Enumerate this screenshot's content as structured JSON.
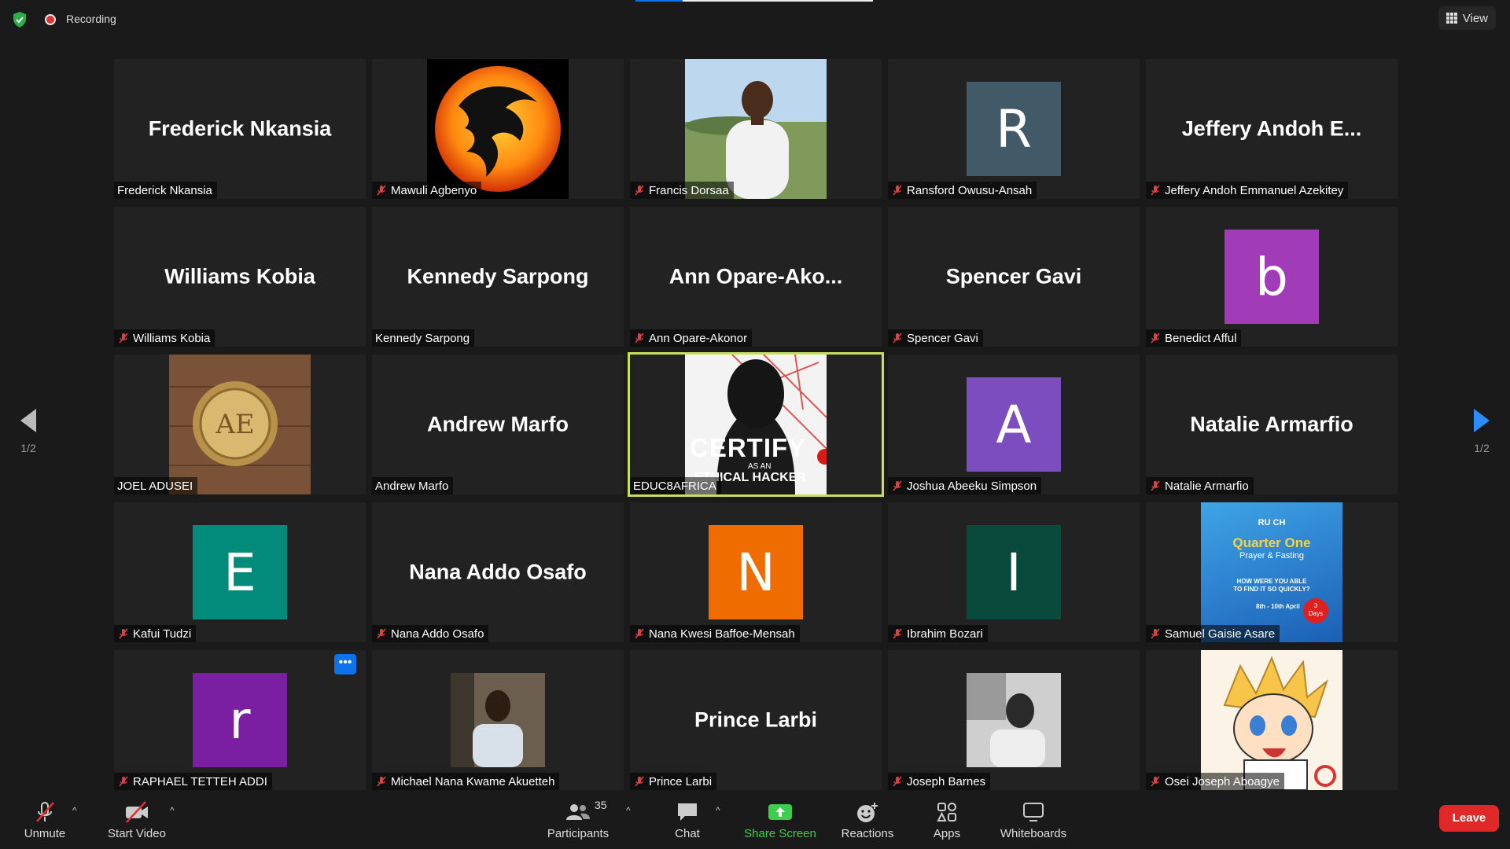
{
  "topbar": {
    "recording_label": "Recording",
    "view_label": "View"
  },
  "pager": {
    "left_label": "1/2",
    "right_label": "1/2"
  },
  "colors": {
    "active_speaker": "#c6e05a",
    "leave": "#e02828",
    "share_screen": "#3ccf4e",
    "accent": "#0e72ed"
  },
  "tiles": [
    {
      "display": "Frederick Nkansia",
      "name": "Frederick Nkansia",
      "muted": false
    },
    {
      "display": "",
      "name": "Mawuli Agbenyo",
      "muted": true,
      "image": "dragon-logo"
    },
    {
      "display": "",
      "name": "Francis Dorsaa",
      "muted": true,
      "image": "person-photo-outdoor"
    },
    {
      "display": "R",
      "name": "Ransford Owusu-Ansah",
      "muted": true,
      "avatar_color": "#425967"
    },
    {
      "display": "Jeffery  Andoh  E...",
      "name": "Jeffery Andoh Emmanuel Azekitey",
      "muted": true
    },
    {
      "display": "Williams Kobia",
      "name": "Williams Kobia",
      "muted": true
    },
    {
      "display": "Kennedy Sarpong",
      "name": "Kennedy Sarpong",
      "muted": false
    },
    {
      "display": "Ann  Opare-Ako...",
      "name": "Ann Opare-Akonor",
      "muted": true
    },
    {
      "display": "Spencer Gavi",
      "name": "Spencer Gavi",
      "muted": true
    },
    {
      "display": "b",
      "name": "Benedict Afful",
      "muted": true,
      "avatar_color": "#a23bb8"
    },
    {
      "display": "",
      "name": "JOEL ADUSEI",
      "muted": false,
      "image": "gold-emblem"
    },
    {
      "display": "Andrew Marfo",
      "name": "Andrew Marfo",
      "muted": false
    },
    {
      "display": "",
      "name": "EDUC8AFRICA",
      "muted": false,
      "active": true,
      "image": "certify-hacker",
      "poster_line1": "CERTIFY",
      "poster_line2": "AS AN",
      "poster_line3": "ETHICAL HACKER"
    },
    {
      "display": "A",
      "name": "Joshua Abeeku Simpson",
      "muted": true,
      "avatar_color": "#7c4dbf"
    },
    {
      "display": "Natalie Armarfio",
      "name": "Natalie Armarfio",
      "muted": true
    },
    {
      "display": "E",
      "name": "Kafui Tudzi",
      "muted": true,
      "avatar_color": "#028a7a"
    },
    {
      "display": "Nana Addo Osafo",
      "name": "Nana Addo Osafo",
      "muted": true
    },
    {
      "display": "N",
      "name": "Nana Kwesi Baffoe-Mensah",
      "muted": true,
      "avatar_color": "#ef6c00"
    },
    {
      "display": "I",
      "name": "Ibrahim Bozari",
      "muted": true,
      "avatar_color": "#0a4a3c"
    },
    {
      "display": "",
      "name": "Samuel Gaisie Asare",
      "muted": true,
      "image": "quarter-one-flyer",
      "flyer_brand": "RU CH",
      "flyer_title": "Quarter One",
      "flyer_sub": "Prayer & Fasting",
      "flyer_q1": "HOW WERE YOU ABLE",
      "flyer_q2": "TO FIND IT SO QUICKLY?",
      "flyer_date": "8th - 10th April",
      "flyer_days_num": "3",
      "flyer_days": "Days"
    },
    {
      "display": "r",
      "name": "RAPHAEL TETTEH ADDI",
      "muted": true,
      "avatar_color": "#7b1fa2",
      "has_more": true
    },
    {
      "display": "",
      "name": "Michael Nana Kwame Akuetteh",
      "muted": true,
      "image": "person-photo-indoor"
    },
    {
      "display": "Prince Larbi",
      "name": "Prince Larbi",
      "muted": true
    },
    {
      "display": "",
      "name": "Joseph Barnes",
      "muted": true,
      "image": "person-photo-bw"
    },
    {
      "display": "",
      "name": "Osei Joseph Aboagye",
      "muted": true,
      "image": "anime-character"
    }
  ],
  "toolbar": {
    "unmute": "Unmute",
    "start_video": "Start Video",
    "participants": "Participants",
    "participants_count": "35",
    "chat": "Chat",
    "share_screen": "Share Screen",
    "reactions": "Reactions",
    "apps": "Apps",
    "whiteboards": "Whiteboards",
    "leave": "Leave"
  }
}
